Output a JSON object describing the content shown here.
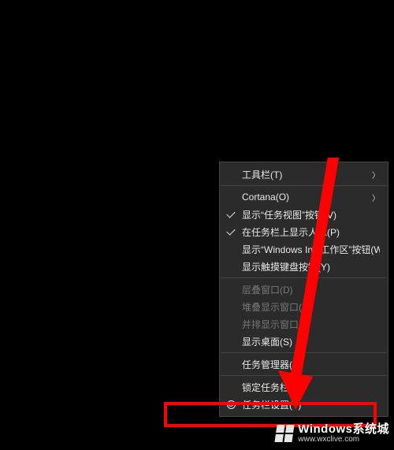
{
  "menu": {
    "toolbars": {
      "label": "工具栏(T)",
      "hasSubmenu": true
    },
    "cortana": {
      "label": "Cortana(O)",
      "hasSubmenu": true
    },
    "taskview": {
      "label": "显示“任务视图”按钮(V)",
      "checked": true
    },
    "people": {
      "label": "在任务栏上显示人脉(P)",
      "checked": true
    },
    "ink": {
      "label": "显示“Windows Ink 工作区”按钮(W)"
    },
    "touchkb": {
      "label": "显示触摸键盘按钮(Y)"
    },
    "cascade": {
      "label": "层叠窗口(D)",
      "disabled": true
    },
    "stackh": {
      "label": "堆叠显示窗口(E)",
      "disabled": true
    },
    "sidebyside": {
      "label": "并排显示窗口(I)",
      "disabled": true
    },
    "showdesktop": {
      "label": "显示桌面(S)"
    },
    "taskmgr": {
      "label": "任务管理器(K)"
    },
    "lock": {
      "label": "锁定任务栏(L)"
    },
    "settings": {
      "label": "任务栏设置(T)",
      "icon": "gear"
    }
  },
  "watermark": {
    "title": "Windows系统城",
    "url": "www.wxclive.com"
  }
}
